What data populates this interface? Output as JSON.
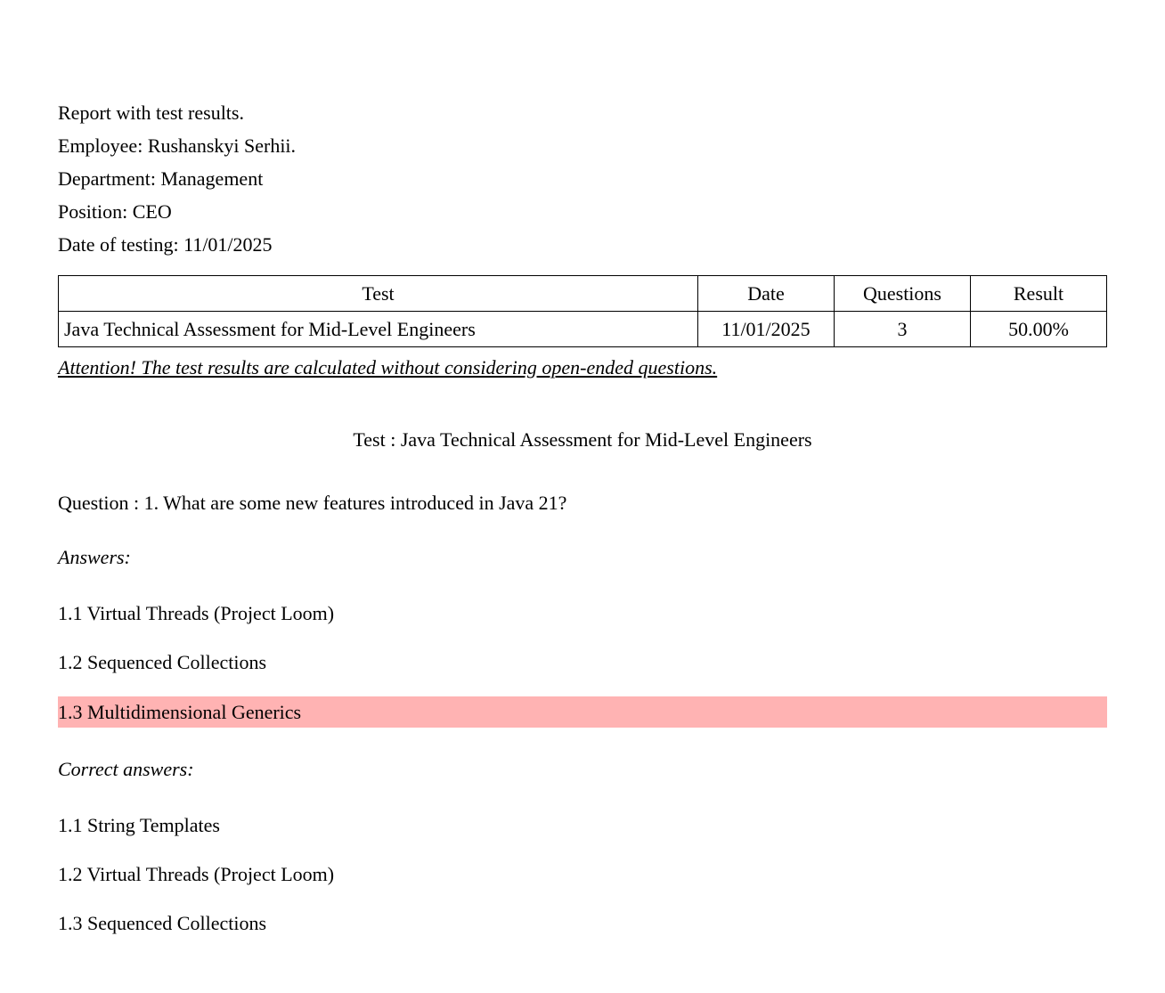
{
  "header": {
    "report_title": "Report with test results.",
    "employee_label": "Employee:",
    "employee_value": "Rushanskyi Serhii.",
    "department_label": "Department:",
    "department_value": "Management",
    "position_label": "Position:",
    "position_value": "CEO",
    "date_label": "Date of testing:",
    "date_value": "11/01/2025"
  },
  "table": {
    "headers": {
      "test": "Test",
      "date": "Date",
      "questions": "Questions",
      "result": "Result"
    },
    "rows": [
      {
        "test": "Java Technical Assessment for Mid-Level Engineers",
        "date": "11/01/2025",
        "questions": "3",
        "result": "50.00%"
      }
    ]
  },
  "attention": "Attention! The test results are calculated without considering open-ended questions.",
  "test_section": {
    "title_prefix": "Test :",
    "title": "Java Technical Assessment for Mid-Level Engineers",
    "question_prefix": "Question :",
    "question": "1. What are some new features introduced in Java 21?",
    "answers_label": "Answers:",
    "answers": [
      {
        "text": "1.1 Virtual Threads (Project Loom)",
        "highlighted": false
      },
      {
        "text": "1.2 Sequenced Collections",
        "highlighted": false
      },
      {
        "text": "1.3 Multidimensional Generics",
        "highlighted": true
      }
    ],
    "correct_label": "Correct answers:",
    "correct_answers": [
      "1.1 String Templates",
      "1.2 Virtual Threads (Project Loom)",
      "1.3 Sequenced Collections"
    ]
  }
}
